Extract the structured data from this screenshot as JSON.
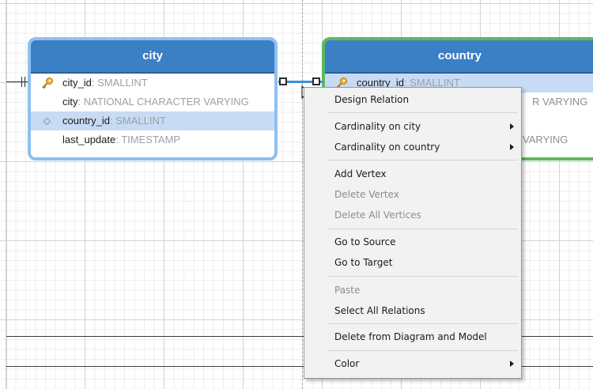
{
  "entities": {
    "city": {
      "title": "city",
      "columns": [
        {
          "name": "city_id",
          "type": ": SMALLINT",
          "key": "primary"
        },
        {
          "name": "city",
          "type": ": NATIONAL CHARACTER VARYING",
          "key": "none"
        },
        {
          "name": "country_id",
          "type": ": SMALLINT",
          "key": "foreign"
        },
        {
          "name": "last_update",
          "type": ": TIMESTAMP",
          "key": "none"
        }
      ]
    },
    "country": {
      "title": "country",
      "columns": [
        {
          "name": "country_id",
          "type": ": SMALLINT",
          "key": "primary"
        },
        {
          "name": "",
          "type": "R VARYING",
          "key": "none"
        },
        {
          "name": "",
          "type": "VARYING",
          "key": "none"
        }
      ]
    }
  },
  "context_menu": {
    "items": [
      {
        "label": "Design Relation",
        "enabled": true,
        "submenu": false
      },
      {
        "label": "Cardinality on city",
        "enabled": true,
        "submenu": true
      },
      {
        "label": "Cardinality on country",
        "enabled": true,
        "submenu": true
      },
      {
        "label": "Add Vertex",
        "enabled": true,
        "submenu": false
      },
      {
        "label": "Delete Vertex",
        "enabled": false,
        "submenu": false
      },
      {
        "label": "Delete All Vertices",
        "enabled": false,
        "submenu": false
      },
      {
        "label": "Go to Source",
        "enabled": true,
        "submenu": false
      },
      {
        "label": "Go to Target",
        "enabled": true,
        "submenu": false
      },
      {
        "label": "Paste",
        "enabled": false,
        "submenu": false
      },
      {
        "label": "Select All Relations",
        "enabled": true,
        "submenu": false
      },
      {
        "label": "Delete from Diagram and Model",
        "enabled": true,
        "submenu": false
      },
      {
        "label": "Color",
        "enabled": true,
        "submenu": true
      }
    ]
  },
  "colors": {
    "entity_header": "#3b7fc4",
    "city_border_selected": "#8ec0f0",
    "country_border": "#5cb85c",
    "highlight_row": "#c8dbf4",
    "relation_line": "#3b8fd6",
    "key_icon": "#f0b429"
  },
  "icons": {
    "primary_key": "key-icon",
    "foreign_key": "diamond-icon",
    "submenu": "chevron-right-icon",
    "cursor": "arrow-cursor-icon"
  }
}
